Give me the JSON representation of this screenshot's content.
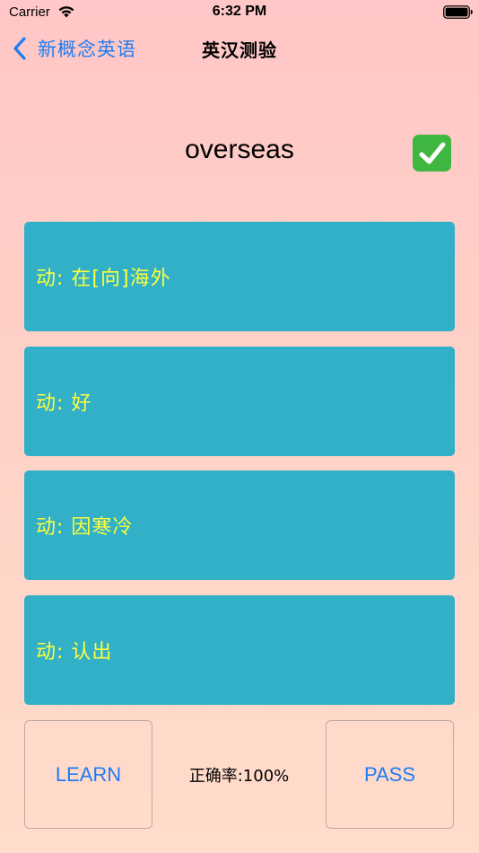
{
  "status_bar": {
    "carrier": "Carrier",
    "time": "6:32 PM"
  },
  "nav": {
    "back_label": "新概念英语",
    "title": "英汉测验"
  },
  "quiz": {
    "word": "overseas",
    "correct_icon": "check-mark-button-icon",
    "options": [
      {
        "label": "动: 在[向]海外"
      },
      {
        "label": "动: 好"
      },
      {
        "label": "动: 因寒冷"
      },
      {
        "label": "动: 认出"
      }
    ]
  },
  "footer": {
    "learn_label": "LEARN",
    "accuracy": "正确率:100%",
    "pass_label": "PASS"
  },
  "colors": {
    "background_top": "#ffc7c7",
    "background_bottom": "#ffdccb",
    "option_fill": "#31b0c8",
    "option_text": "#ffff3a",
    "link_blue": "#1f7cf2",
    "check_green": "#3fb63f"
  }
}
